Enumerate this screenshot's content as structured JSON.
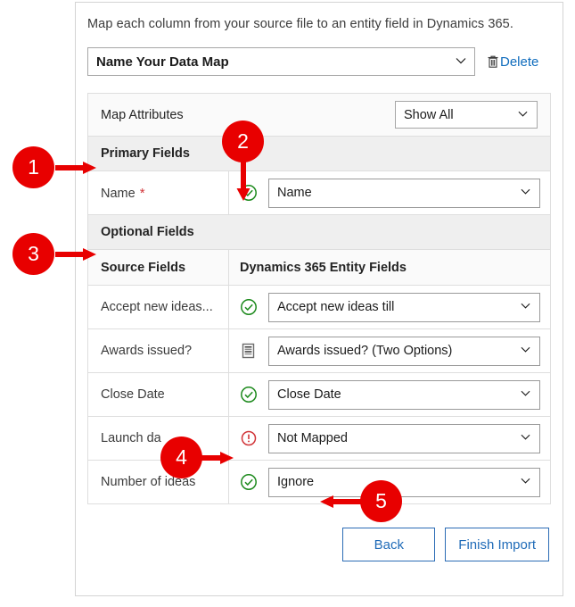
{
  "dialog": {
    "instruction": "Map each column from your source file to an entity field in Dynamics 365.",
    "data_map": {
      "value": "Name Your Data Map",
      "chevron_icon": "chevron-down-icon"
    },
    "delete": {
      "label": "Delete",
      "icon": "trash-icon"
    }
  },
  "attributes_header": {
    "title": "Map Attributes",
    "filter": {
      "value": "Show All",
      "chevron_icon": "chevron-down-icon"
    }
  },
  "sections": {
    "primary": "Primary Fields",
    "optional": "Optional Fields"
  },
  "columns": {
    "source": "Source Fields",
    "entity": "Dynamics 365 Entity Fields"
  },
  "primary_rows": [
    {
      "source": "Name",
      "required": true,
      "required_marker": "*",
      "status_icon": "green-check-circle-icon",
      "status": "mapped",
      "entity": "Name"
    }
  ],
  "optional_rows": [
    {
      "source": "Accept new ideas...",
      "required": false,
      "status_icon": "green-check-circle-icon",
      "status": "mapped",
      "entity": "Accept new ideas till"
    },
    {
      "source": "Awards issued?",
      "required": false,
      "status_icon": "list-document-icon",
      "status": "option-set",
      "entity": "Awards issued? (Two Options)"
    },
    {
      "source": "Close Date",
      "required": false,
      "status_icon": "green-check-circle-icon",
      "status": "mapped",
      "entity": "Close Date"
    },
    {
      "source": "Launch da",
      "required": false,
      "status_icon": "red-error-circle-icon",
      "status": "not-mapped",
      "entity": "Not Mapped"
    },
    {
      "source": "Number of ideas",
      "required": false,
      "status_icon": "green-check-circle-icon",
      "status": "mapped",
      "entity": "Ignore"
    }
  ],
  "footer": {
    "back": "Back",
    "finish": "Finish Import"
  },
  "callouts": [
    {
      "number": "1",
      "points_to": "Primary Fields"
    },
    {
      "number": "2",
      "points_to": "Name row status icon"
    },
    {
      "number": "3",
      "points_to": "Optional Fields"
    },
    {
      "number": "4",
      "points_to": "Launch date error icon"
    },
    {
      "number": "5",
      "points_to": "Ignore value"
    }
  ],
  "colors": {
    "accent": "#0f6cbd",
    "callout": "#e80000",
    "success": "#1d8a1d",
    "error": "#d13438",
    "required": "#d13438"
  }
}
